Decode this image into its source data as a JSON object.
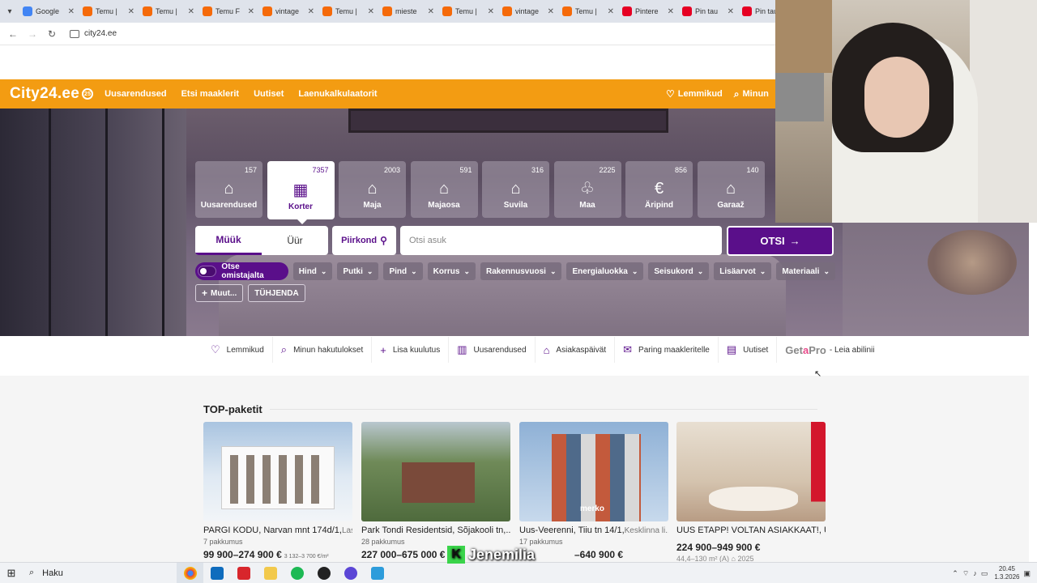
{
  "browser": {
    "tabs": [
      {
        "title": "Google",
        "icon": "google-icon",
        "color": "#4285f4"
      },
      {
        "title": "Temu |",
        "icon": "temu-icon",
        "color": "#f56a0a"
      },
      {
        "title": "Temu |",
        "icon": "temu-icon",
        "color": "#f56a0a"
      },
      {
        "title": "Temu F",
        "icon": "temu-icon",
        "color": "#f56a0a"
      },
      {
        "title": "vintage",
        "icon": "temu-icon",
        "color": "#f56a0a"
      },
      {
        "title": "Temu |",
        "icon": "temu-icon",
        "color": "#f56a0a"
      },
      {
        "title": "mieste",
        "icon": "temu-icon",
        "color": "#f56a0a"
      },
      {
        "title": "Temu |",
        "icon": "temu-icon",
        "color": "#f56a0a"
      },
      {
        "title": "vintage",
        "icon": "temu-icon",
        "color": "#f56a0a"
      },
      {
        "title": "Temu |",
        "icon": "temu-icon",
        "color": "#f56a0a"
      },
      {
        "title": "Pintere",
        "icon": "pinterest-icon",
        "color": "#e60023"
      },
      {
        "title": "Pin tau",
        "icon": "pinterest-icon",
        "color": "#e60023"
      },
      {
        "title": "Pin tau",
        "icon": "pinterest-icon",
        "color": "#e60023"
      }
    ],
    "url": "city24.ee"
  },
  "header": {
    "logo": "City24.ee",
    "logo_badge": "25",
    "nav": [
      "Uusarendused",
      "Etsi maaklerit",
      "Uutiset",
      "Laenukalkulaatorit"
    ],
    "favorites": "Lemmikud",
    "my_searches": "Minun"
  },
  "categories": [
    {
      "label": "Uusarendused",
      "count": "157",
      "icon": "new-development-icon",
      "glyph": "⌂"
    },
    {
      "label": "Korter",
      "count": "7357",
      "icon": "apartment-icon",
      "glyph": "▦",
      "active": true
    },
    {
      "label": "Maja",
      "count": "2003",
      "icon": "house-icon",
      "glyph": "⌂"
    },
    {
      "label": "Majaosa",
      "count": "591",
      "icon": "house-part-icon",
      "glyph": "⌂"
    },
    {
      "label": "Suvila",
      "count": "316",
      "icon": "cottage-icon",
      "glyph": "⌂"
    },
    {
      "label": "Maa",
      "count": "2225",
      "icon": "land-icon",
      "glyph": "♧"
    },
    {
      "label": "Äripind",
      "count": "856",
      "icon": "commercial-icon",
      "glyph": "€"
    },
    {
      "label": "Garaaž",
      "count": "140",
      "icon": "garage-icon",
      "glyph": "⌂"
    }
  ],
  "search": {
    "deal_buy": "Müük",
    "deal_rent": "Üür",
    "region": "Piirkond",
    "placeholder": "Otsi asuk",
    "button": "OTSI"
  },
  "filters": {
    "owner_toggle": "Otse omistajalta",
    "chips": [
      "Hind",
      "Putki",
      "Pind",
      "Korrus",
      "Rakennusvuosi",
      "Energialuokka",
      "Seisukord",
      "Lisäarvot",
      "Materiaali"
    ],
    "more": "Muut...",
    "clear": "TÜHJENDA"
  },
  "quick_links": [
    {
      "label": "Lemmikud",
      "icon": "heart-icon",
      "glyph": "♡"
    },
    {
      "label": "Minun hakutulokset",
      "icon": "saved-search-icon",
      "glyph": "⌕"
    },
    {
      "label": "Lisa kuulutus",
      "icon": "plus-icon",
      "glyph": "+"
    },
    {
      "label": "Uusarendused",
      "icon": "building-icon",
      "glyph": "▥"
    },
    {
      "label": "Asiakaspäivät",
      "icon": "open-house-icon",
      "glyph": "⌂"
    },
    {
      "label": "Paring maakleritelle",
      "icon": "mail-icon",
      "glyph": "✉"
    },
    {
      "label": "Uutiset",
      "icon": "news-icon",
      "glyph": "▤"
    }
  ],
  "getapro": {
    "brand_a": "Get",
    "brand_b": "a",
    "brand_c": "Pro",
    "text": "- Leia abilinii"
  },
  "top": {
    "title": "TOP-paketit",
    "cards": [
      {
        "title": "PARGI KODU, Narvan mnt 174d/1,",
        "loc": "Las...",
        "offers": "7 pakkumus",
        "price": "99 900–274 900 €",
        "sqm": "3 132–3 700 €/m²"
      },
      {
        "title": "Park Tondi Residentsid, Sõjakooli tn,...",
        "loc": "",
        "offers": "28 pakkumus",
        "price": "227 000–675 000 €",
        "sqm": ""
      },
      {
        "title": "Uus-Veerenni, Tiiu tn 14/1,",
        "loc": "Kesklinna li...",
        "offers": "17 pakkumus",
        "price": "–640 900 €",
        "sqm": "",
        "brand": "merko"
      },
      {
        "title": "UUS ETAPP! VOLTAN ASIAKKAAT!, U...",
        "loc": "",
        "offers": "",
        "price": "224 900–949 900 €",
        "sqm": "",
        "meta": "44,4–130 m²   (A)   ⌂ 2025"
      }
    ]
  },
  "taskbar": {
    "search": "Haku",
    "time": "20.45",
    "date": "1.3.2026",
    "overlay_name": "Jenemilia"
  }
}
